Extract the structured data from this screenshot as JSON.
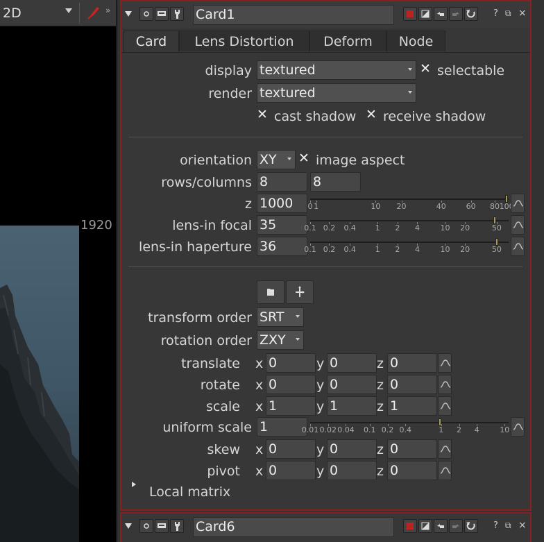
{
  "viewer": {
    "mode": "2D",
    "format_label": "1920"
  },
  "panel": {
    "title": "Card1",
    "tabs": [
      {
        "label": "Card"
      },
      {
        "label": "Lens Distortion"
      },
      {
        "label": "Deform"
      },
      {
        "label": "Node"
      }
    ],
    "display": {
      "label": "display",
      "value": "textured",
      "selectable_label": "selectable"
    },
    "render": {
      "label": "render",
      "value": "textured"
    },
    "shadows": {
      "cast": "cast shadow",
      "receive": "receive shadow"
    },
    "orientation": {
      "label": "orientation",
      "value": "XY",
      "aspect_label": "image aspect"
    },
    "rows_columns": {
      "label": "rows/columns",
      "rows": "8",
      "columns": "8"
    },
    "z": {
      "label": "z",
      "value": "1000",
      "ticks": [
        "0",
        "1",
        "10",
        "20",
        "40",
        "60",
        "80",
        "100"
      ],
      "level": 1000
    },
    "lens_focal": {
      "label": "lens-in focal",
      "value": "35",
      "ticks": [
        "0.1",
        "0.2",
        "0.4",
        "1",
        "2",
        "4",
        "10",
        "20",
        "50"
      ],
      "level": 35
    },
    "lens_haperture": {
      "label": "lens-in haperture",
      "value": "36",
      "ticks": [
        "0.1",
        "0.2",
        "0.4",
        "1",
        "2",
        "4",
        "10",
        "20",
        "50"
      ],
      "level": 36
    },
    "transform_order": {
      "label": "transform order",
      "value": "SRT"
    },
    "rotation_order": {
      "label": "rotation order",
      "value": "ZXY"
    },
    "axes": {
      "x": "x",
      "y": "y",
      "z": "z"
    },
    "translate": {
      "label": "translate",
      "x": "0",
      "y": "0",
      "z": "0"
    },
    "rotate": {
      "label": "rotate",
      "x": "0",
      "y": "0",
      "z": "0"
    },
    "scale": {
      "label": "scale",
      "x": "1",
      "y": "1",
      "z": "1"
    },
    "uniform_scale": {
      "label": "uniform scale",
      "value": "1",
      "ticks": [
        "0.01",
        "0.02",
        "0.04",
        "0.1",
        "0.2",
        "0.4",
        "1",
        "2",
        "4",
        "10"
      ],
      "level": 1
    },
    "skew": {
      "label": "skew",
      "x": "0",
      "y": "0",
      "z": "0"
    },
    "pivot": {
      "label": "pivot",
      "x": "0",
      "y": "0",
      "z": "0"
    },
    "local_matrix": "Local matrix"
  },
  "next_panel": {
    "title": "Card6"
  },
  "colors": {
    "panel_border": "#8a1f1f",
    "knob": "#a89b5a",
    "paint_icon": "#cc2222"
  }
}
